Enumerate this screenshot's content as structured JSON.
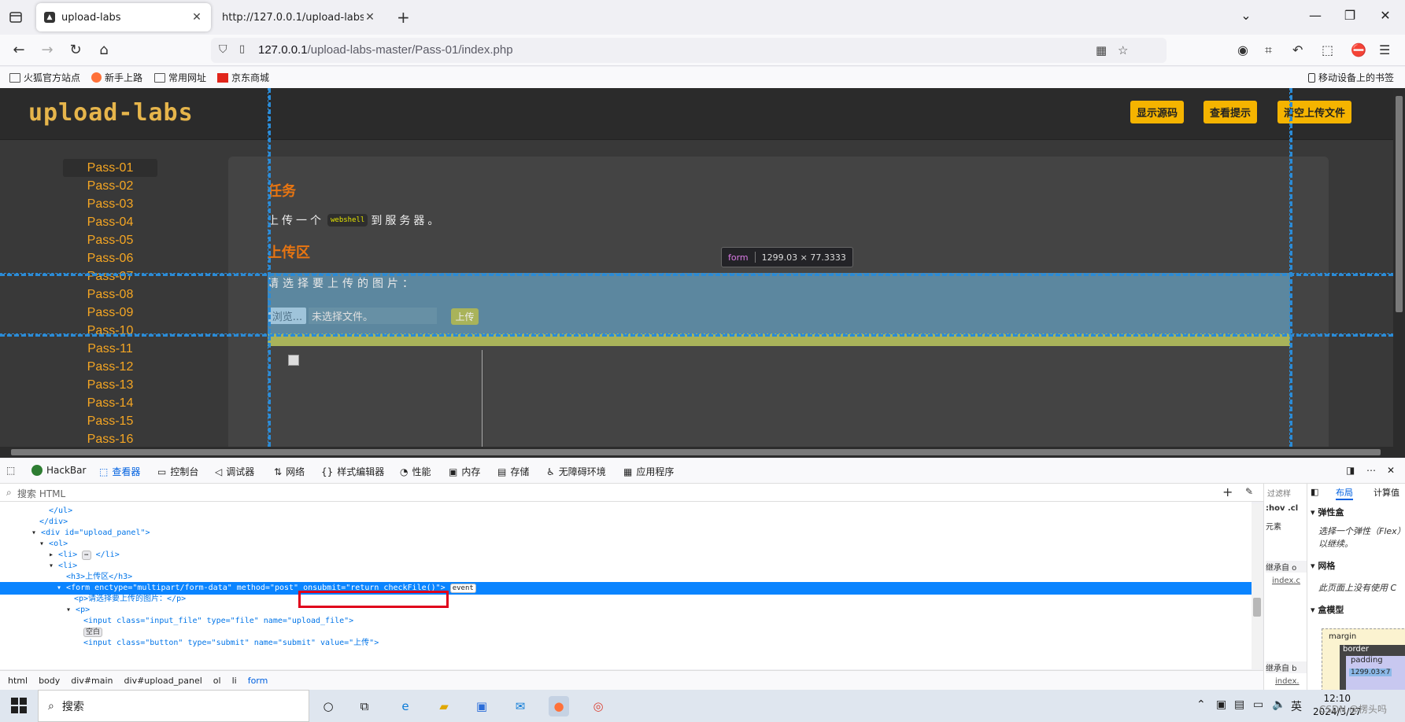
{
  "browser": {
    "active_tab": "upload-labs",
    "inactive_tab": "http://127.0.0.1/upload-labs-mas",
    "url_host": "127.0.0.1",
    "url_path": "/upload-labs-master/Pass-01/index.php"
  },
  "bookmarks": [
    "火狐官方站点",
    "新手上路",
    "常用网址",
    "京东商城"
  ],
  "mobile_bookmarks": "移动设备上的书签",
  "page": {
    "logo": "upload-labs",
    "header_buttons": [
      "显示源码",
      "查看提示",
      "清空上传文件"
    ],
    "passes": [
      "Pass-01",
      "Pass-02",
      "Pass-03",
      "Pass-04",
      "Pass-05",
      "Pass-06",
      "Pass-07",
      "Pass-08",
      "Pass-09",
      "Pass-10",
      "Pass-11",
      "Pass-12",
      "Pass-13",
      "Pass-14",
      "Pass-15",
      "Pass-16"
    ],
    "task_title": "任务",
    "task_text_before": "上传一个",
    "task_code": "webshell",
    "task_text_after": "到服务器。",
    "upload_title": "上传区",
    "prompt": "请选择要上传的图片：",
    "browse_label": "浏览...",
    "file_status": "未选择文件。",
    "upload_label": "上传",
    "tooltip_tag": "form",
    "tooltip_size": "1299.03 × 77.3333"
  },
  "devtools": {
    "tabs": [
      "HackBar",
      "查看器",
      "控制台",
      "调试器",
      "网络",
      "样式编辑器",
      "性能",
      "内存",
      "存储",
      "无障碍环境",
      "应用程序"
    ],
    "search_placeholder": "搜索 HTML",
    "tree": [
      "</ul>",
      "</div>",
      "<div id=\"upload_panel\">",
      "<ol>",
      "<li>",
      "<li>",
      "<h3>上传区</h3>",
      "<form enctype=\"multipart/form-data\" method=\"post\" onsubmit=\"return checkFile()\">",
      "<p>请选择要上传的图片：</p>",
      "<p>",
      "<input class=\"input_file\" type=\"file\" name=\"upload_file\">",
      "空白",
      "<input class=\"button\" type=\"submit\" name=\"submit\" value=\"上传\">"
    ],
    "event_badge": "event",
    "breadcrumbs": [
      "html",
      "body",
      "div#main",
      "div#upload_panel",
      "ol",
      "li",
      "form"
    ],
    "rules": {
      "filter": "过滤样",
      "hov": ":hov .cl",
      "element": "元素",
      "inherit1": "继承自 o",
      "file": "index.c",
      "inherit2": "继承自 b",
      "file2": "index."
    },
    "layout": {
      "tabs": [
        "布局",
        "计算值"
      ],
      "flex_title": "弹性盒",
      "flex_text": "选择一个弹性（Flex）目以继续。",
      "grid_title": "网格",
      "grid_text": "此页面上没有使用 C",
      "box_title": "盒模型",
      "margin": "margin",
      "border": "border",
      "padding": "padding",
      "size": "1299.03×7"
    }
  },
  "taskbar": {
    "search": "搜索",
    "ime": "英",
    "time": "12:10",
    "date": "2024/3/27",
    "watermark": "CSDN @楞头吗"
  }
}
